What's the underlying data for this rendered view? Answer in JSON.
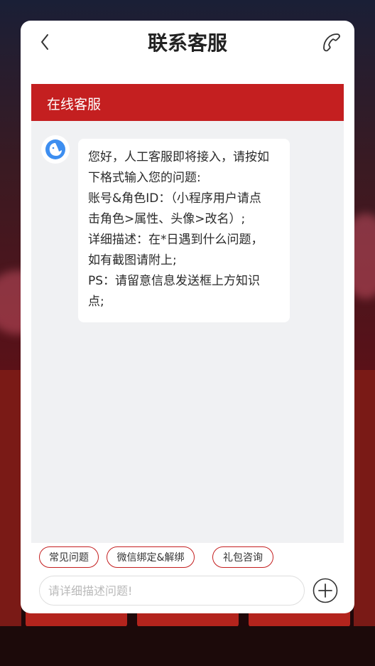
{
  "header": {
    "title": "联系客服"
  },
  "panel": {
    "title": "在线客服"
  },
  "message": {
    "lines": [
      "您好，人工客服即将接入，请按如",
      "下格式输入您的问题:",
      "账号&角色ID：（小程序用户请点",
      "击角色>属性、头像>改名）;",
      "详细描述：在*日遇到什么问题，",
      "如有截图请附上;",
      "PS：请留意信息发送框上方知识",
      "点;"
    ]
  },
  "quick_replies": [
    {
      "label": "常见问题"
    },
    {
      "label": "微信绑定&解绑"
    },
    {
      "label": "礼包咨询"
    }
  ],
  "composer": {
    "placeholder": "请详细描述问题!"
  },
  "colors": {
    "accent": "#c41f20",
    "chat_bg": "#f0f1f3",
    "avatar": "#3d8ef0"
  }
}
